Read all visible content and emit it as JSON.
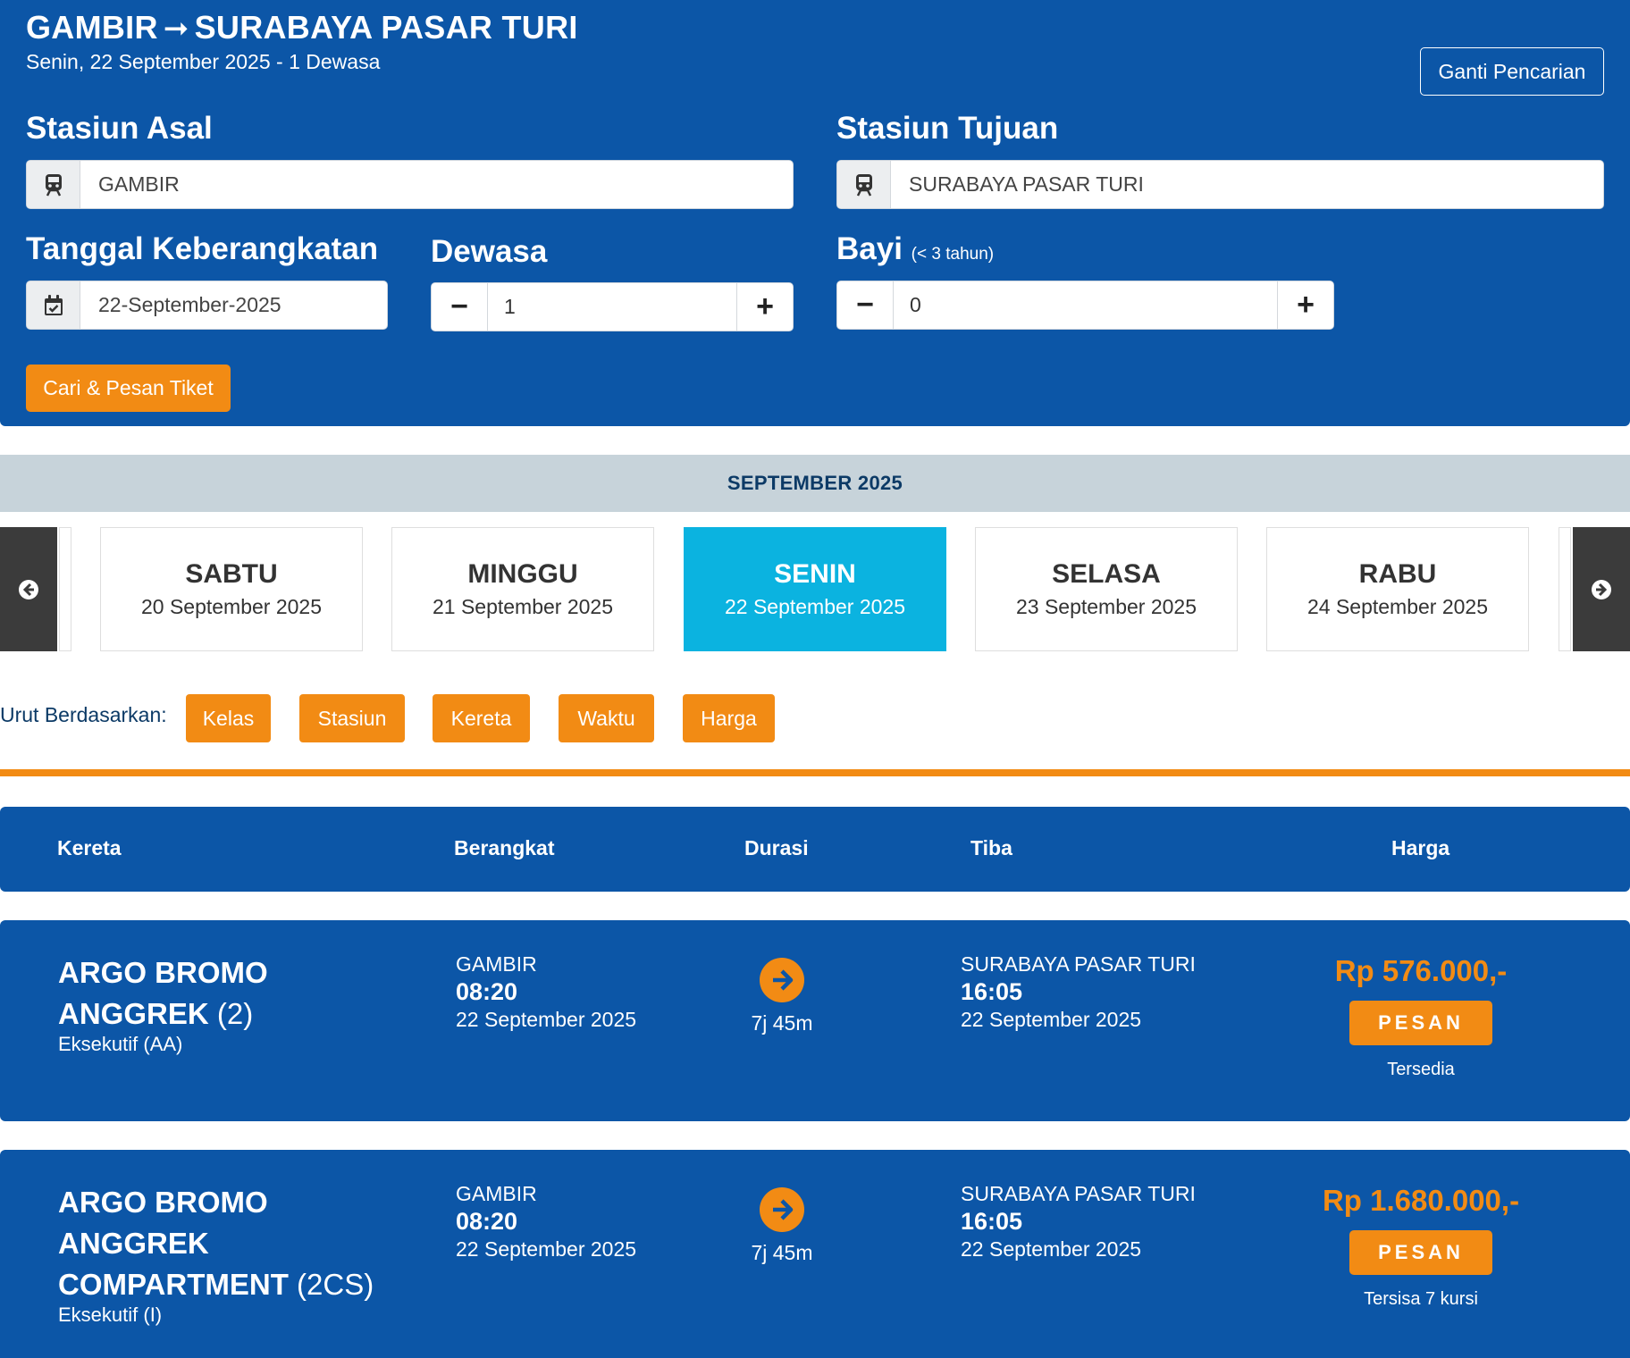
{
  "header": {
    "origin": "GAMBIR",
    "destination": "SURABAYA PASAR TURI",
    "arrow": "➞",
    "subtitle": "Senin, 22 September 2025 - 1 Dewasa",
    "change_label": "Ganti Pencarian"
  },
  "form": {
    "origin_label": "Stasiun Asal",
    "origin_value": "GAMBIR",
    "destination_label": "Stasiun Tujuan",
    "destination_value": "SURABAYA PASAR TURI",
    "date_label": "Tanggal Keberangkatan",
    "date_value": "22-September-2025",
    "adult_label": "Dewasa",
    "adult_value": "1",
    "infant_label": "Bayi",
    "infant_note": "(< 3 tahun)",
    "infant_value": "0",
    "minus": "−",
    "plus": "+",
    "submit_label": "Cari & Pesan Tiket"
  },
  "calendar": {
    "month_label": "SEPTEMBER 2025",
    "days": [
      {
        "name": "SABTU",
        "date": "20 September 2025"
      },
      {
        "name": "MINGGU",
        "date": "21 September 2025"
      },
      {
        "name": "SENIN",
        "date": "22 September 2025"
      },
      {
        "name": "SELASA",
        "date": "23 September 2025"
      },
      {
        "name": "RABU",
        "date": "24 September 2025"
      }
    ],
    "active_index": 2
  },
  "sort": {
    "label": "Urut Berdasarkan:",
    "options": [
      "Kelas",
      "Stasiun",
      "Kereta",
      "Waktu",
      "Harga"
    ]
  },
  "table": {
    "headers": [
      "Kereta",
      "Berangkat",
      "Durasi",
      "Tiba",
      "Harga"
    ]
  },
  "trains": [
    {
      "name": "ARGO BROMO ANGGREK",
      "code": "(2)",
      "class": "Eksekutif (AA)",
      "dep_station": "GAMBIR",
      "dep_time": "08:20",
      "dep_date": "22 September 2025",
      "duration": "7j 45m",
      "arr_station": "SURABAYA PASAR TURI",
      "arr_time": "16:05",
      "arr_date": "22 September 2025",
      "price": "Rp 576.000,-",
      "book_label": "PESAN",
      "availability": "Tersedia"
    },
    {
      "name": "ARGO BROMO ANGGREK COMPARTMENT",
      "code": "(2CS)",
      "class": "Eksekutif (I)",
      "dep_station": "GAMBIR",
      "dep_time": "08:20",
      "dep_date": "22 September 2025",
      "duration": "7j 45m",
      "arr_station": "SURABAYA PASAR TURI",
      "arr_time": "16:05",
      "arr_date": "22 September 2025",
      "price": "Rp 1.680.000,-",
      "book_label": "PESAN",
      "availability": "Tersisa 7 kursi"
    }
  ],
  "colors": {
    "primary": "#0c56a7",
    "accent": "#f28b14",
    "active_day": "#0bb3e0"
  },
  "icons": {
    "station": "train-icon",
    "date": "calendar-check-icon",
    "prev": "circle-arrow-left-icon",
    "next": "circle-arrow-right-icon",
    "duration": "circle-arrow-right-icon"
  }
}
